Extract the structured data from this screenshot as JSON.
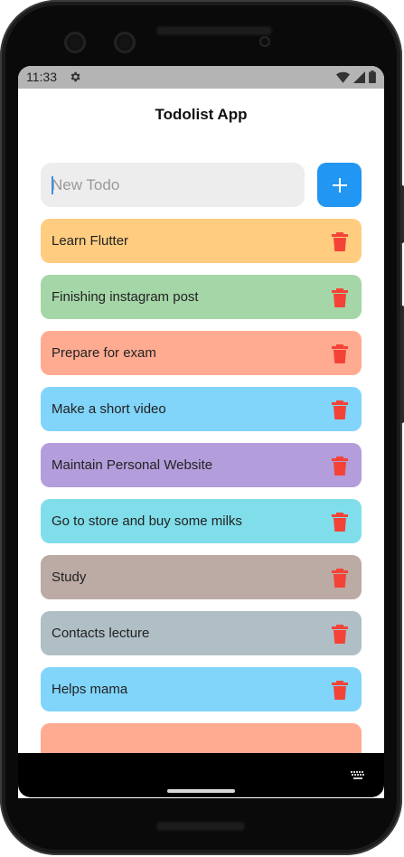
{
  "status_bar": {
    "time": "11:33",
    "icons": [
      "gear-icon",
      "wifi-icon",
      "signal-icon",
      "battery-icon"
    ]
  },
  "app": {
    "title": "Todolist App"
  },
  "new_todo": {
    "placeholder": "New Todo",
    "value": ""
  },
  "add_button": {
    "icon": "plus-icon",
    "color": "#2196f3"
  },
  "todos": [
    {
      "label": "Learn Flutter",
      "color": "#ffcc80"
    },
    {
      "label": "Finishing instagram post",
      "color": "#a5d6a7"
    },
    {
      "label": "Prepare for exam",
      "color": "#ffab91"
    },
    {
      "label": "Make a short video",
      "color": "#81d4fa"
    },
    {
      "label": "Maintain Personal Website",
      "color": "#b39ddb"
    },
    {
      "label": "Go to store and buy some milks",
      "color": "#80deea"
    },
    {
      "label": "Study",
      "color": "#bcaaa4"
    },
    {
      "label": "Contacts lecture",
      "color": "#b0bec5"
    },
    {
      "label": "Helps mama",
      "color": "#81d4fa"
    },
    {
      "label": "",
      "color": "#ffab91"
    }
  ],
  "delete_icon_color": "#f44336",
  "nav_bar": {
    "icons": [
      "keyboard-icon"
    ]
  }
}
